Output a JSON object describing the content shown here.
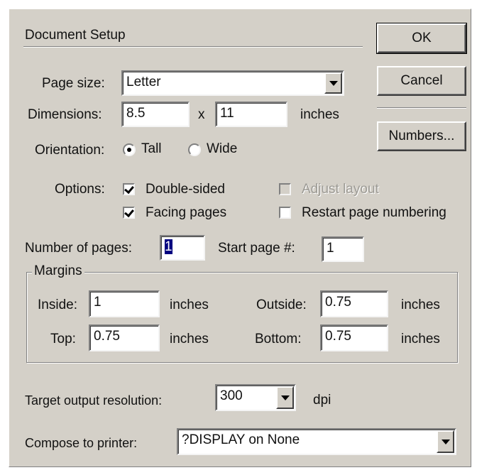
{
  "dialog": {
    "title": "Document Setup",
    "buttons": {
      "ok": "OK",
      "cancel": "Cancel",
      "numbers": "Numbers..."
    }
  },
  "page_size": {
    "label": "Page size:",
    "value": "Letter"
  },
  "dimensions": {
    "label": "Dimensions:",
    "width": "8.5",
    "times": "x",
    "height": "11",
    "unit": "inches"
  },
  "orientation": {
    "label": "Orientation:",
    "tall": "Tall",
    "wide": "Wide",
    "selected": "Tall"
  },
  "options": {
    "label": "Options:",
    "double_sided": {
      "label": "Double-sided",
      "checked": true
    },
    "facing_pages": {
      "label": "Facing pages",
      "checked": true
    },
    "adjust_layout": {
      "label": "Adjust layout",
      "checked": false,
      "disabled": true
    },
    "restart_numbering": {
      "label": "Restart page numbering",
      "checked": false
    }
  },
  "number_of_pages": {
    "label": "Number of pages:",
    "value": "1"
  },
  "start_page": {
    "label": "Start page #:",
    "value": "1"
  },
  "margins": {
    "label": "Margins",
    "inside": {
      "label": "Inside:",
      "value": "1",
      "unit": "inches"
    },
    "outside": {
      "label": "Outside:",
      "value": "0.75",
      "unit": "inches"
    },
    "top": {
      "label": "Top:",
      "value": "0.75",
      "unit": "inches"
    },
    "bottom": {
      "label": "Bottom:",
      "value": "0.75",
      "unit": "inches"
    }
  },
  "resolution": {
    "label": "Target output resolution:",
    "value": "300",
    "unit": "dpi"
  },
  "printer": {
    "label": "Compose to printer:",
    "value": "?DISPLAY on None"
  }
}
